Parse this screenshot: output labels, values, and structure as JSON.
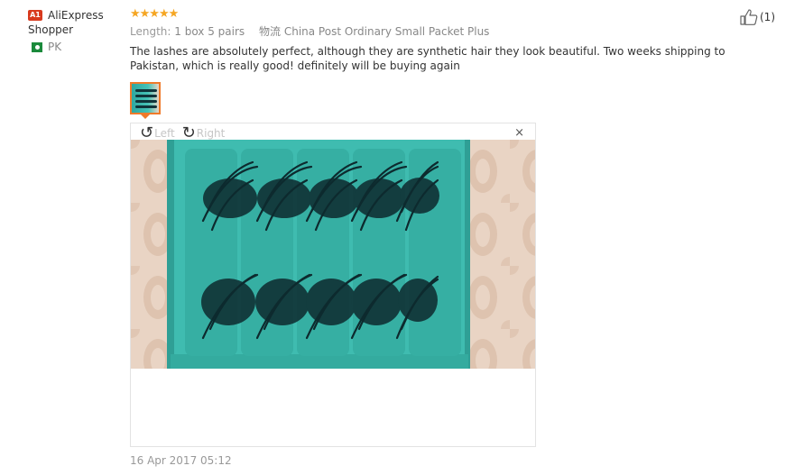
{
  "user": {
    "badge": "A1",
    "name_line1": "AliExpress",
    "name_line2": "Shopper",
    "country": "PK"
  },
  "review": {
    "stars": "★★★★★",
    "rating": 5,
    "length_label": "Length:",
    "length_value": "1 box 5 pairs",
    "logistics_label": "物流",
    "logistics_value": "China Post Ordinary Small Packet Plus",
    "text": "The lashes are absolutely perfect, although they are synthetic hair they look beautiful. Two weeks shipping to Pakistan, which is really good! definitely will be buying again",
    "date": "16 Apr 2017 05:12"
  },
  "helpful": {
    "icon": "thumbs-up-icon",
    "count": "(1)"
  },
  "viewer": {
    "rotate_left_label": "Left",
    "rotate_right_label": "Right",
    "rotate_left_icon": "rotate-left-icon",
    "rotate_right_icon": "rotate-right-icon",
    "close_label": "×"
  },
  "colors": {
    "star": "#f5a623",
    "badge": "#d83a1e",
    "thumb_border": "#f07a2a",
    "tray": "#3fbcb0",
    "background_pattern": "#e9d4c4"
  }
}
